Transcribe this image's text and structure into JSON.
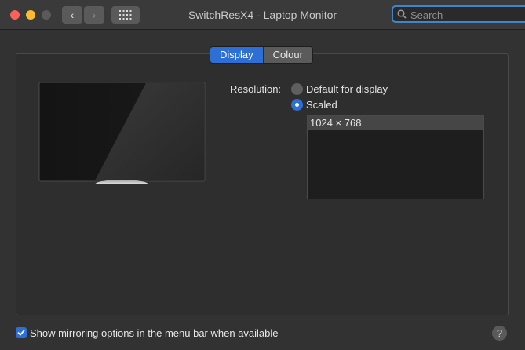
{
  "window": {
    "title": "SwitchResX4 - Laptop Monitor",
    "back_glyph": "‹",
    "forward_glyph": "›",
    "help_glyph": "?"
  },
  "search": {
    "placeholder": "Search",
    "value": ""
  },
  "tabs": [
    {
      "label": "Display",
      "active": true
    },
    {
      "label": "Colour",
      "active": false
    }
  ],
  "resolution": {
    "label": "Resolution:",
    "options": [
      {
        "label": "Default for display",
        "selected": false
      },
      {
        "label": "Scaled",
        "selected": true
      }
    ],
    "list": [
      "1024 × 768"
    ]
  },
  "footer": {
    "mirroring_label": "Show mirroring options in the menu bar when available",
    "mirroring_checked": true
  },
  "colors": {
    "accent": "#2d6fd4",
    "window_bg": "#323232",
    "close": "#fe5f57",
    "minimize": "#febb2e"
  },
  "icons": {
    "back": "chevron-left-icon",
    "forward": "chevron-right-icon",
    "grid": "grid-icon",
    "search": "search-icon",
    "help": "question-icon",
    "check": "checkmark-icon"
  }
}
